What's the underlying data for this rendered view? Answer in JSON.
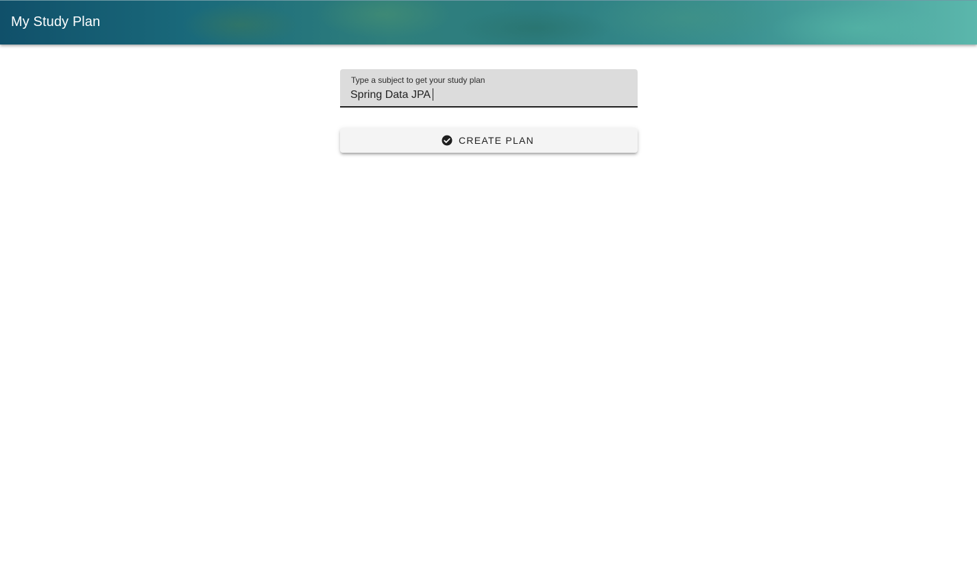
{
  "app_bar": {
    "title": "My Study Plan"
  },
  "subject_field": {
    "label": "Type a subject to get your study plan",
    "value": "Spring Data JPA"
  },
  "create_button": {
    "label": "CREATE PLAN",
    "icon": "check-circle-icon"
  },
  "colors": {
    "app_bar_start": "#10506a",
    "app_bar_end": "#5bb7ac",
    "field_background": "#dcdcdc",
    "button_background": "#f4f4f4",
    "text_dark": "#1e1e1e"
  }
}
